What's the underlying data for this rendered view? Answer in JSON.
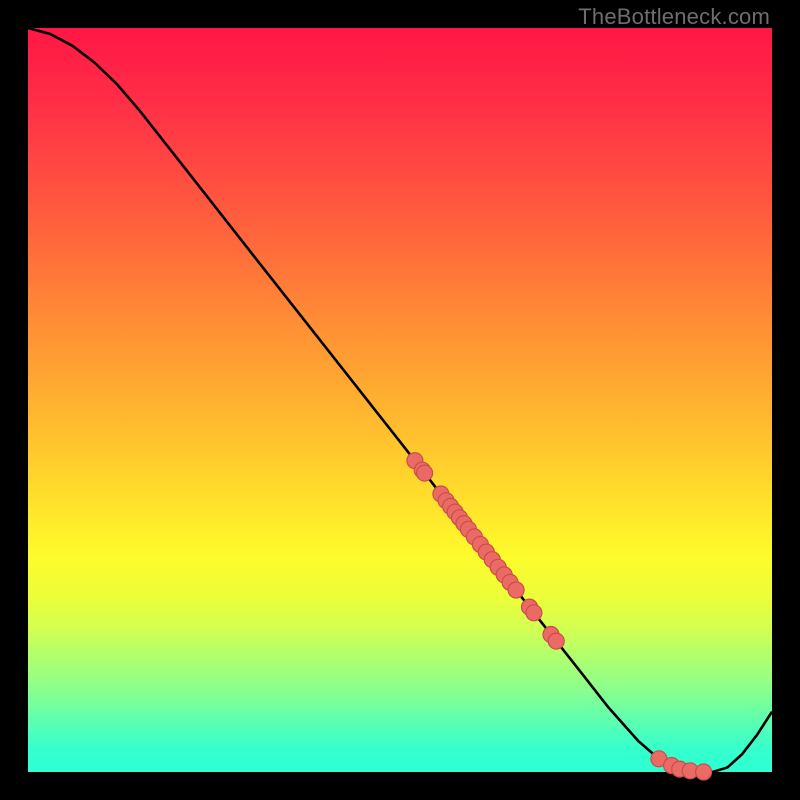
{
  "watermark": "TheBottleneck.com",
  "chart_data": {
    "type": "line",
    "title": "",
    "xlabel": "",
    "ylabel": "",
    "x_range": [
      0,
      100
    ],
    "y_range": [
      0,
      100
    ],
    "curve": [
      {
        "x": 0.0,
        "y": 100.0
      },
      {
        "x": 3.0,
        "y": 99.2
      },
      {
        "x": 6.0,
        "y": 97.6
      },
      {
        "x": 9.0,
        "y": 95.3
      },
      {
        "x": 12.0,
        "y": 92.4
      },
      {
        "x": 15.0,
        "y": 88.9
      },
      {
        "x": 18.0,
        "y": 85.1
      },
      {
        "x": 22.0,
        "y": 80.0
      },
      {
        "x": 30.0,
        "y": 69.8
      },
      {
        "x": 40.0,
        "y": 57.1
      },
      {
        "x": 50.0,
        "y": 44.4
      },
      {
        "x": 60.0,
        "y": 31.6
      },
      {
        "x": 68.0,
        "y": 21.4
      },
      {
        "x": 74.0,
        "y": 13.8
      },
      {
        "x": 78.0,
        "y": 8.7
      },
      {
        "x": 82.0,
        "y": 4.2
      },
      {
        "x": 85.0,
        "y": 1.6
      },
      {
        "x": 87.5,
        "y": 0.4
      },
      {
        "x": 90.0,
        "y": 0.0
      },
      {
        "x": 92.0,
        "y": 0.0
      },
      {
        "x": 94.0,
        "y": 0.6
      },
      {
        "x": 96.0,
        "y": 2.4
      },
      {
        "x": 98.0,
        "y": 5.0
      },
      {
        "x": 100.0,
        "y": 8.1
      }
    ],
    "markers_x": [
      52.0,
      53.0,
      53.3,
      55.5,
      56.2,
      56.8,
      57.4,
      58.0,
      58.6,
      59.2,
      60.0,
      60.8,
      61.6,
      62.4,
      63.2,
      64.0,
      64.8,
      65.6,
      67.4,
      68.0,
      70.3,
      71.0,
      84.8,
      86.5,
      87.6,
      89.0,
      90.8
    ],
    "marker_radius_px": 8,
    "colors": {
      "curve": "#000000",
      "marker_fill": "#eb6a65",
      "marker_stroke": "#c94e4a"
    }
  }
}
